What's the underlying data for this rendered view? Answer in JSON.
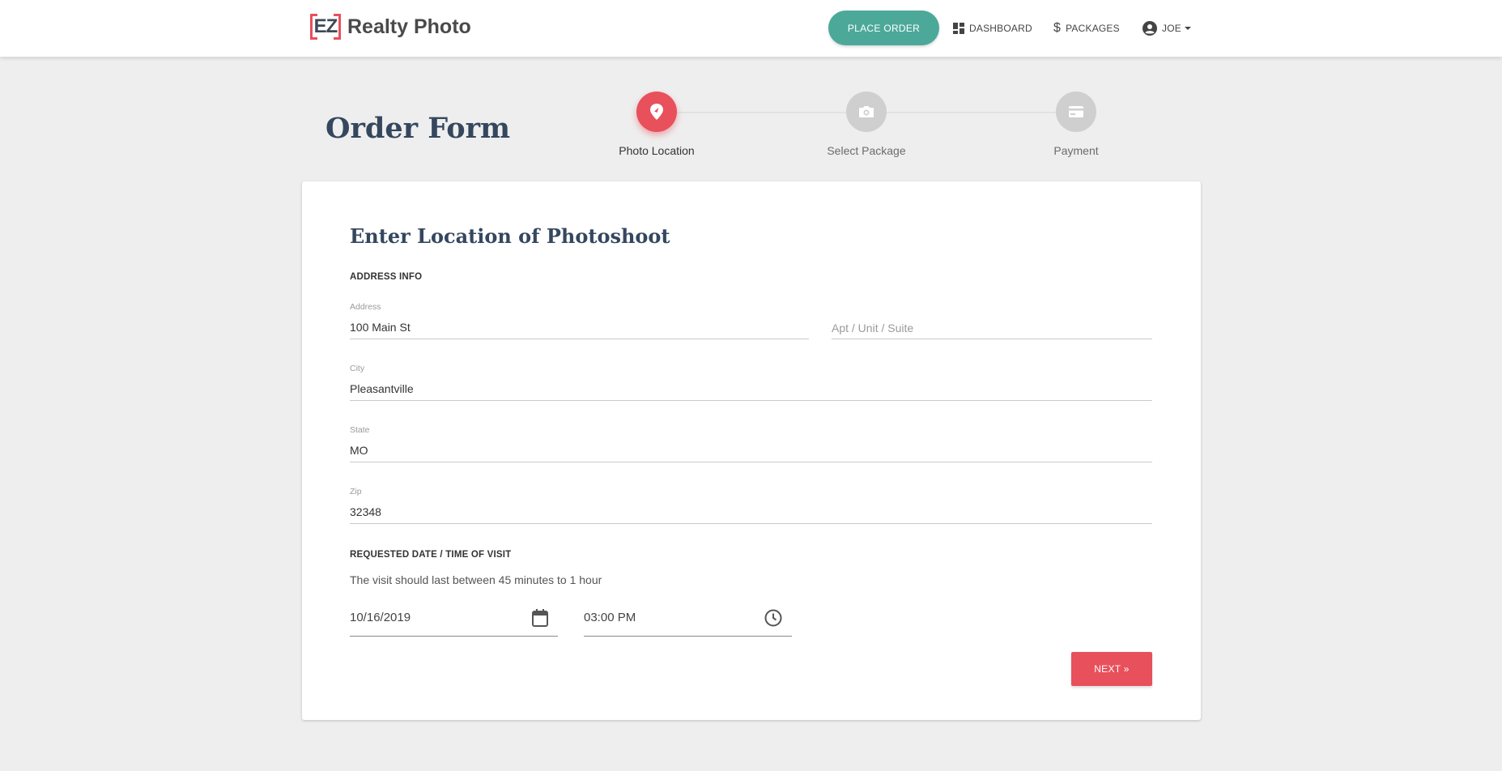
{
  "brand": {
    "mark": "EZ",
    "name": "Realty Photo"
  },
  "nav": {
    "place_order": "PLACE ORDER",
    "dashboard": "DASHBOARD",
    "packages": "PACKAGES",
    "user": "JOE"
  },
  "page": {
    "title": "Order Form"
  },
  "stepper": {
    "steps": [
      {
        "label": "Photo Location",
        "icon": "location-pin-icon",
        "active": true
      },
      {
        "label": "Select Package",
        "icon": "camera-icon",
        "active": false
      },
      {
        "label": "Payment",
        "icon": "credit-card-icon",
        "active": false
      }
    ]
  },
  "form": {
    "title": "Enter Location of Photoshoot",
    "address_section": "ADDRESS INFO",
    "address": {
      "label": "Address",
      "value": "100 Main St"
    },
    "apt": {
      "placeholder": "Apt / Unit / Suite"
    },
    "city": {
      "label": "City",
      "value": "Pleasantville"
    },
    "state": {
      "label": "State",
      "value": "MO"
    },
    "zip": {
      "label": "Zip",
      "value": "32348"
    },
    "datetime_section": "REQUESTED DATE / TIME OF VISIT",
    "hint": "The visit should last between 45 minutes to 1 hour",
    "date": {
      "value": "10/16/2019",
      "icon": "calendar-icon"
    },
    "time": {
      "value": "03:00 PM",
      "icon": "clock-icon"
    },
    "next_button": "NEXT »"
  },
  "colors": {
    "accent": "#e8505b",
    "teal": "#4ca99a",
    "heading": "#34475e",
    "background": "#eeeeee"
  }
}
